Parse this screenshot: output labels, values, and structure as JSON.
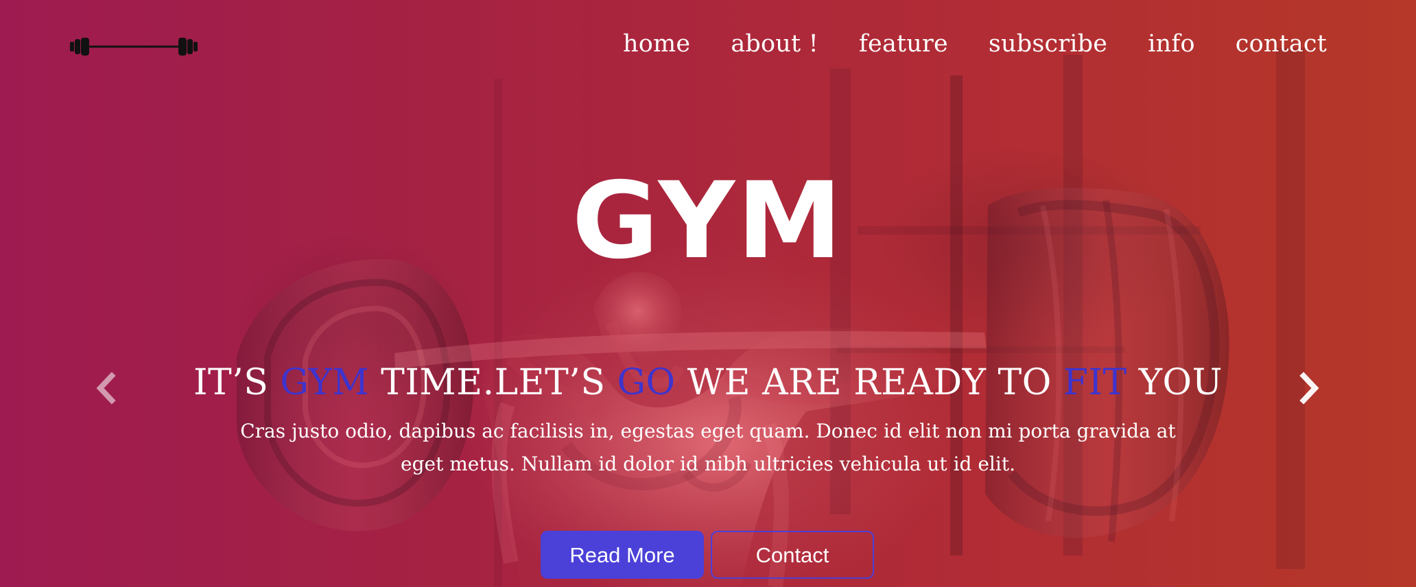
{
  "nav": {
    "logo_icon": "barbell-icon",
    "links": [
      "home",
      "about !",
      "feature",
      "subscribe",
      "info",
      "contact"
    ]
  },
  "hero": {
    "title": "GYM",
    "subtitle_parts": [
      "IT’S ",
      "GYM",
      " TIME.LET’S ",
      "GO",
      " WE ARE READY TO ",
      "FIT",
      " YOU"
    ],
    "description": "Cras justo odio, dapibus ac facilisis in, egestas eget quam. Donec id elit non mi porta gravida at eget metus. Nullam id dolor id nibh ultricies vehicula ut id elit.",
    "buttons": {
      "read_more": "Read More",
      "contact": "Contact"
    }
  },
  "icons": {
    "prev": "chevron-left-icon",
    "next": "chevron-right-icon"
  },
  "colors": {
    "accent": "#3d34cf",
    "button": "#4b40d8",
    "text": "#ffffff"
  }
}
